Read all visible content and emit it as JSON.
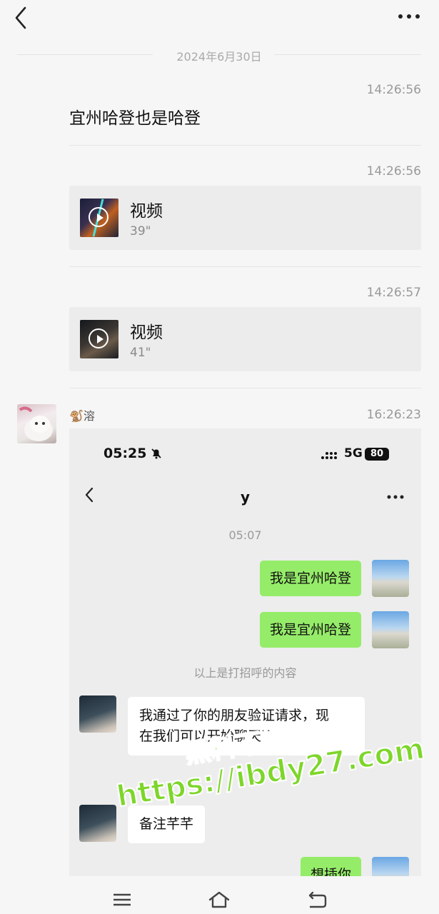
{
  "header": {
    "back_icon": "chevron-left-icon",
    "more_icon": "more-dots-icon"
  },
  "chat": {
    "date": "2024年6月30日",
    "messages": [
      {
        "time": "14:26:56",
        "text": "宜州哈登也是哈登"
      },
      {
        "time": "14:26:56",
        "title": "视频",
        "duration": "39\""
      },
      {
        "time": "14:26:57",
        "title": "视频",
        "duration": "41\""
      },
      {
        "time": "16:26:23",
        "sender": "🐒溶"
      }
    ]
  },
  "screenshot": {
    "status_time": "05:25",
    "network": "5G",
    "battery": "80",
    "contact_title": "y",
    "clock": "05:07",
    "outgoing": [
      "我是宜州哈登",
      "我是宜州哈登"
    ],
    "system_note": "以上是打招呼的内容",
    "incoming_1": [
      "我通过了你的朋友验证请求，现",
      "在我们可以开始聊天了"
    ],
    "incoming_2": "备注芊芊",
    "outgoing_last": "想插你"
  },
  "watermark": {
    "line1": "黑料不打烊",
    "line2": "https://ibdy27.com"
  },
  "colors": {
    "bubble_green": "#95ec69",
    "background": "#f6f6f6",
    "watermark": "#7dd62a"
  },
  "navbar": {
    "icons": [
      "menu-icon",
      "home-icon",
      "back-icon"
    ]
  }
}
